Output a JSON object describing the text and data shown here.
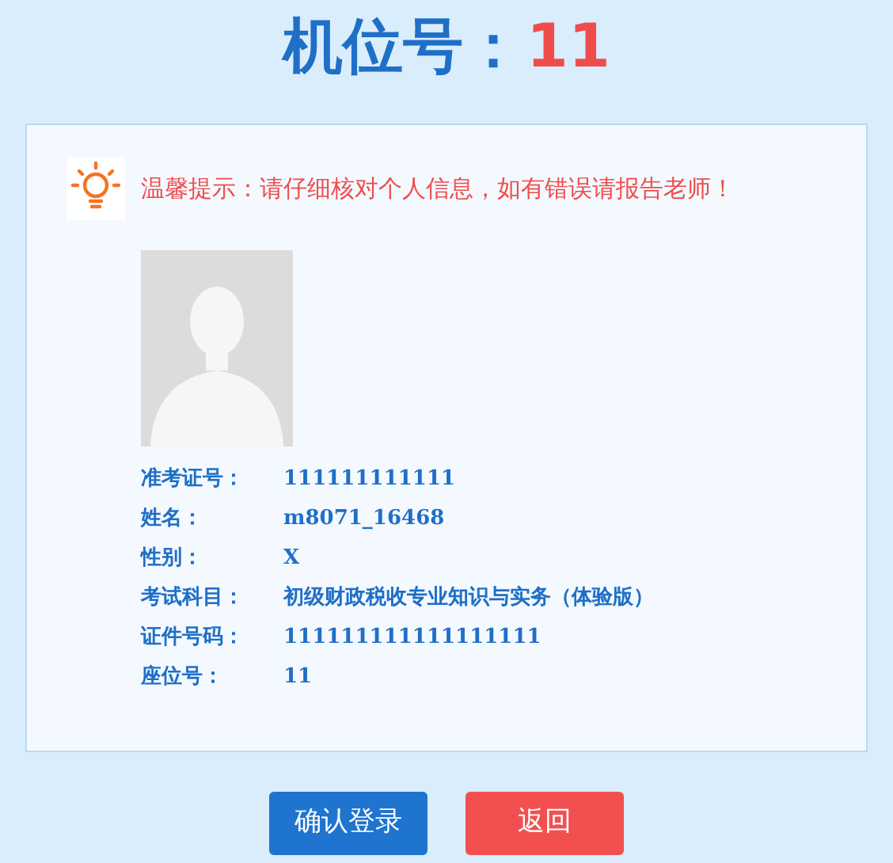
{
  "header": {
    "label": "机位号：",
    "value": "11"
  },
  "notice": {
    "text": "温馨提示：请仔细核对个人信息，如有错误请报告老师！"
  },
  "photo": {
    "kind": "avatar"
  },
  "info_rows": [
    {
      "label": "准考证号：",
      "value": "111111111111"
    },
    {
      "label": "姓名：",
      "value": "m8071_16468"
    },
    {
      "label": "性别：",
      "value": "X"
    },
    {
      "label": "考试科目：",
      "value": "初级财政税收专业知识与实务（体验版）"
    },
    {
      "label": "证件号码：",
      "value": "111111111111111111"
    },
    {
      "label": "座位号：",
      "value": "11"
    }
  ],
  "buttons": [
    {
      "label": "确认登录",
      "kind": "primary"
    },
    {
      "label": "返回",
      "kind": "danger"
    }
  ]
}
